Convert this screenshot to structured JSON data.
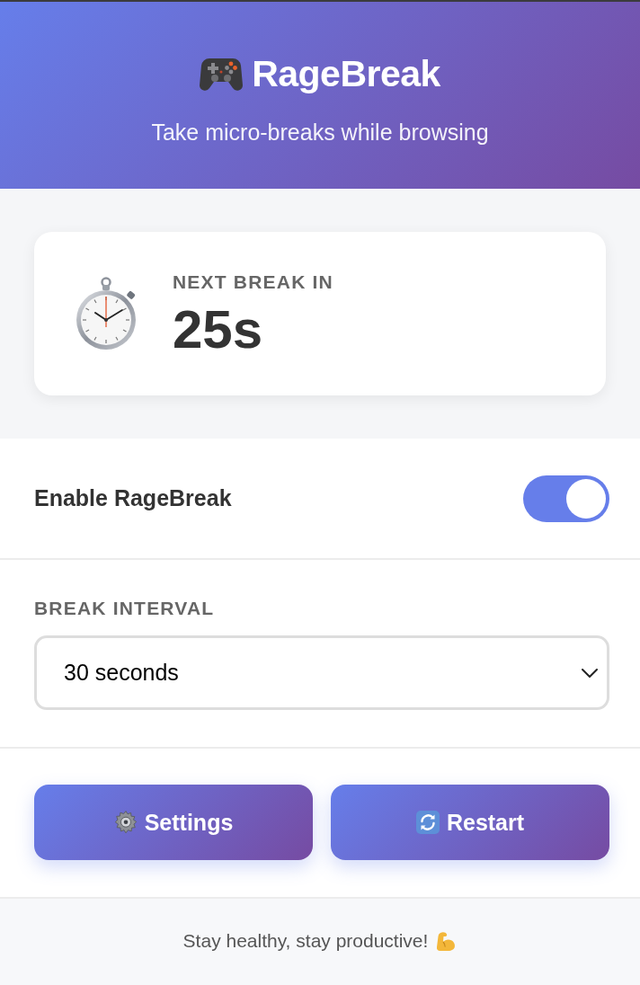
{
  "header": {
    "title": "RageBreak",
    "subtitle": "Take micro-breaks while browsing"
  },
  "countdown": {
    "label": "NEXT BREAK IN",
    "value": "25s"
  },
  "toggle": {
    "label": "Enable RageBreak",
    "on": true
  },
  "interval": {
    "label": "BREAK INTERVAL",
    "value": "30 seconds"
  },
  "buttons": [
    {
      "label": "Settings",
      "kind": "settings"
    },
    {
      "label": "Restart",
      "kind": "restart"
    }
  ],
  "footer": {
    "text": "Stay healthy, stay productive!"
  }
}
